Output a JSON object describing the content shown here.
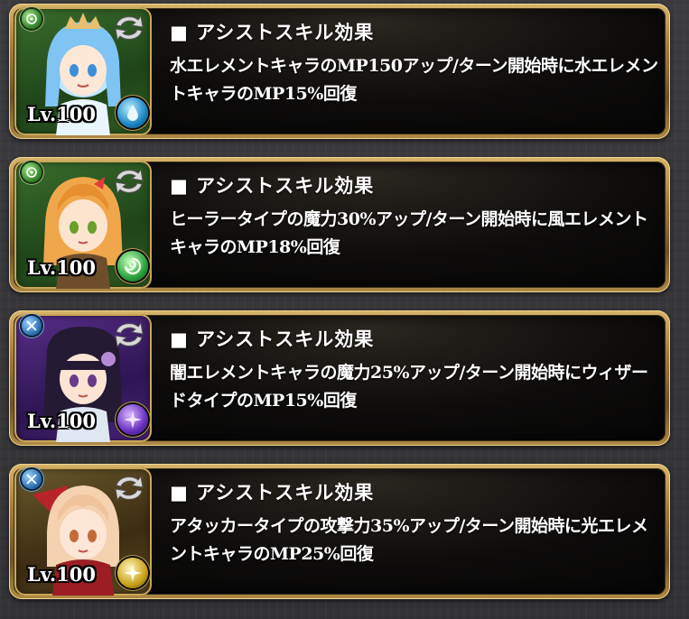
{
  "cards": [
    {
      "level": "Lv.100",
      "element": "water",
      "element_icon": "water-drop-icon",
      "type_badge": "green",
      "title": "■ アシストスキル効果",
      "description": "水エレメントキャラのMP150アップ/ターン開始時に水エレメントキャラのMP15%回復"
    },
    {
      "level": "Lv.100",
      "element": "wind",
      "element_icon": "wind-swirl-icon",
      "type_badge": "green",
      "title": "■ アシストスキル効果",
      "description": "ヒーラータイプの魔力30%アップ/ターン開始時に風エレメントキャラのMP18%回復"
    },
    {
      "level": "Lv.100",
      "element": "dark",
      "element_icon": "dark-star-icon",
      "type_badge": "blue",
      "title": "■ アシストスキル効果",
      "description": "闇エレメントキャラの魔力25%アップ/ターン開始時にウィザードタイプのMP15%回復"
    },
    {
      "level": "Lv.100",
      "element": "light",
      "element_icon": "light-star-icon",
      "type_badge": "blue",
      "title": "■ アシストスキル効果",
      "description": "アタッカータイプの攻撃力35%アップ/ターン開始時に光エレメントキャラのMP25%回復"
    }
  ],
  "colors": {
    "frame_gold": "#c9a757",
    "text": "#ffffff",
    "panel_bg": "#0c0b0a"
  }
}
